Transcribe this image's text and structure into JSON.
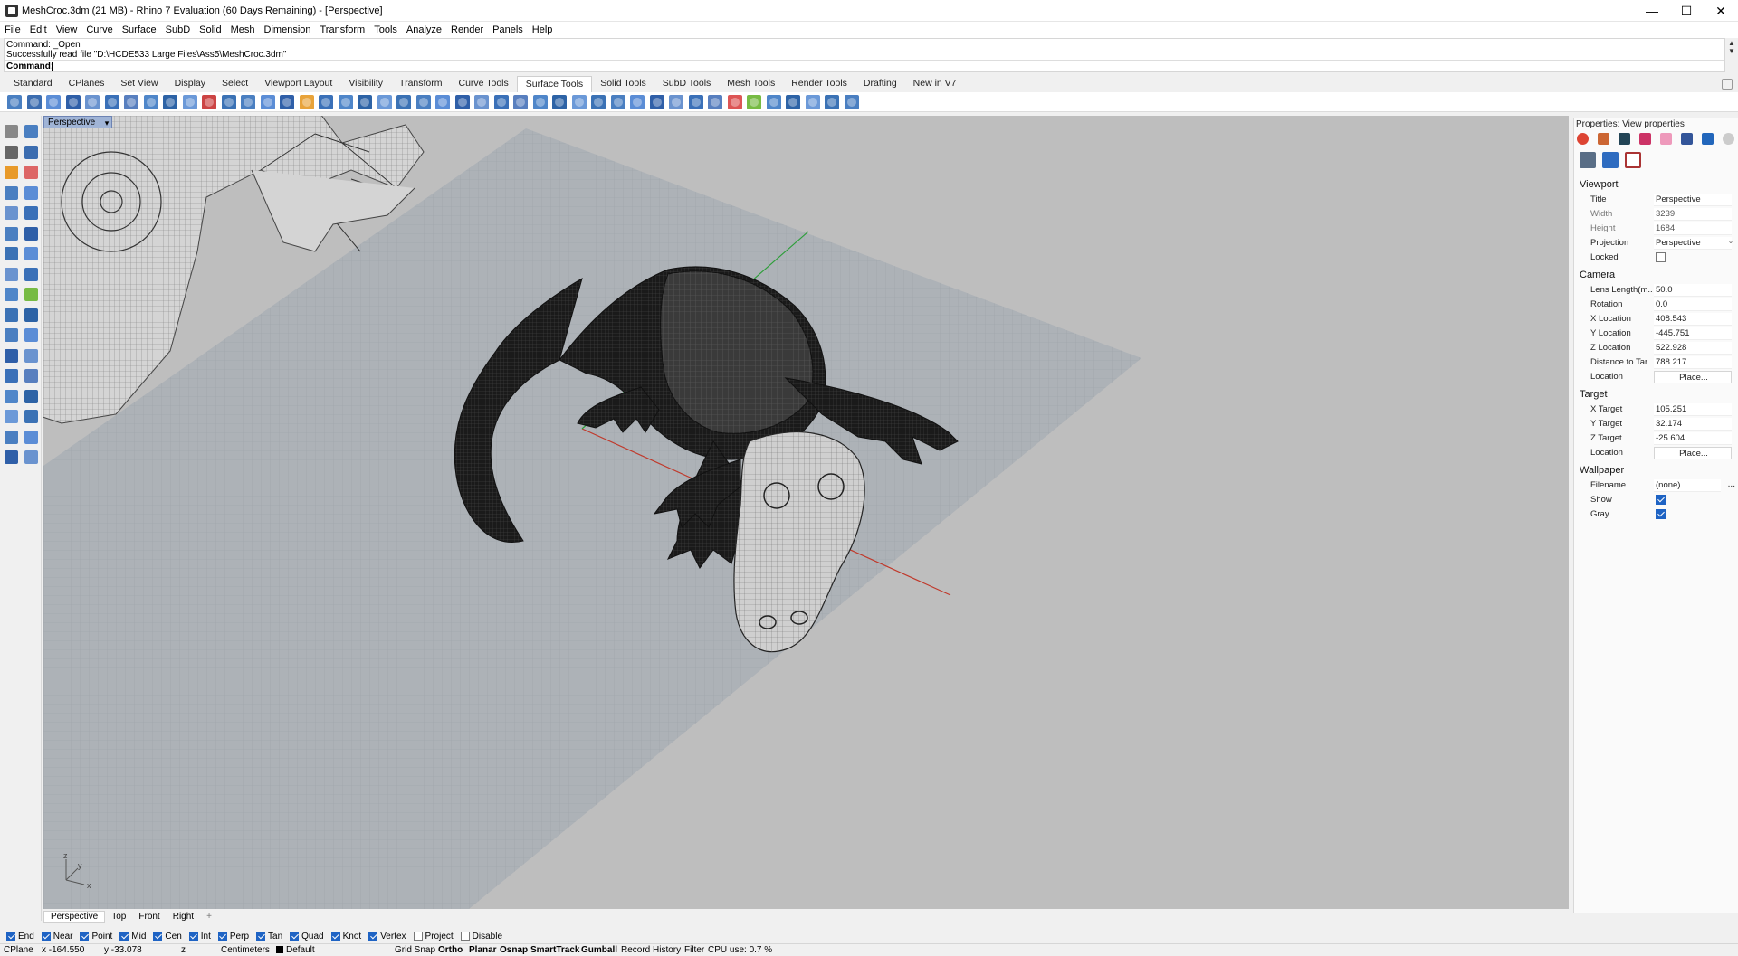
{
  "window": {
    "title": "MeshCroc.3dm (21 MB) - Rhino 7 Evaluation (60 Days Remaining) - [Perspective]",
    "minimize": "—",
    "maximize": "☐",
    "close": "✕"
  },
  "menu": [
    "File",
    "Edit",
    "View",
    "Curve",
    "Surface",
    "SubD",
    "Solid",
    "Mesh",
    "Dimension",
    "Transform",
    "Tools",
    "Analyze",
    "Render",
    "Panels",
    "Help"
  ],
  "command": {
    "history": [
      "Command: _Open",
      "Successfully read file \"D:\\HCDE533 Large Files\\Ass5\\MeshCroc.3dm\""
    ],
    "prompt": "Command:",
    "value": ""
  },
  "toolbar_tabs": [
    "Standard",
    "CPlanes",
    "Set View",
    "Display",
    "Select",
    "Viewport Layout",
    "Visibility",
    "Transform",
    "Curve Tools",
    "Surface Tools",
    "Solid Tools",
    "SubD Tools",
    "Mesh Tools",
    "Render Tools",
    "Drafting",
    "New in V7"
  ],
  "active_toolbar_tab": "Surface Tools",
  "viewport": {
    "label": "Perspective",
    "axis_z": "z",
    "axis_y": "y",
    "axis_x": "x",
    "tabs": [
      "Perspective",
      "Top",
      "Front",
      "Right"
    ],
    "active_tab": "Perspective",
    "add_tab": "+"
  },
  "properties": {
    "title": "Properties: View properties",
    "viewport": {
      "section": "Viewport",
      "title_label": "Title",
      "title_value": "Perspective",
      "width_label": "Width",
      "width_value": "3239",
      "height_label": "Height",
      "height_value": "1684",
      "projection_label": "Projection",
      "projection_value": "Perspective",
      "locked_label": "Locked"
    },
    "camera": {
      "section": "Camera",
      "lens_label": "Lens Length(m...",
      "lens_value": "50.0",
      "rotation_label": "Rotation",
      "rotation_value": "0.0",
      "xloc_label": "X Location",
      "xloc_value": "408.543",
      "yloc_label": "Y Location",
      "yloc_value": "-445.751",
      "zloc_label": "Z Location",
      "zloc_value": "522.928",
      "dist_label": "Distance to Tar...",
      "dist_value": "788.217",
      "location_label": "Location",
      "location_button": "Place..."
    },
    "target": {
      "section": "Target",
      "xt_label": "X Target",
      "xt_value": "105.251",
      "yt_label": "Y Target",
      "yt_value": "32.174",
      "zt_label": "Z Target",
      "zt_value": "-25.604",
      "location_label": "Location",
      "location_button": "Place..."
    },
    "wallpaper": {
      "section": "Wallpaper",
      "filename_label": "Filename",
      "filename_value": "(none)",
      "filename_more": "...",
      "show_label": "Show",
      "gray_label": "Gray"
    }
  },
  "osnaps": [
    {
      "label": "End",
      "checked": true
    },
    {
      "label": "Near",
      "checked": true
    },
    {
      "label": "Point",
      "checked": true
    },
    {
      "label": "Mid",
      "checked": true
    },
    {
      "label": "Cen",
      "checked": true
    },
    {
      "label": "Int",
      "checked": true
    },
    {
      "label": "Perp",
      "checked": true
    },
    {
      "label": "Tan",
      "checked": true
    },
    {
      "label": "Quad",
      "checked": true
    },
    {
      "label": "Knot",
      "checked": true
    },
    {
      "label": "Vertex",
      "checked": true
    },
    {
      "label": "Project",
      "checked": false
    },
    {
      "label": "Disable",
      "checked": false
    }
  ],
  "status": {
    "cplane": "CPlane",
    "x": "x -164.550",
    "y": "y -33.078",
    "z": "z",
    "units": "Centimeters",
    "layer": "Default",
    "grid_snap": "Grid Snap",
    "ortho": "Ortho",
    "planar": "Planar",
    "osnap": "Osnap",
    "smarttrack": "SmartTrack",
    "gumball": "Gumball",
    "record_history": "Record History",
    "filter": "Filter",
    "cpu": "CPU use: 0.7 %"
  },
  "colors": {
    "viewport_bg": "#bebebe",
    "grid_plane": "#adb2b7",
    "grid_line": "#9aa0a6",
    "x_axis": "#c0392b",
    "y_axis": "#2e9e3a",
    "accent": "#1e63c4"
  }
}
